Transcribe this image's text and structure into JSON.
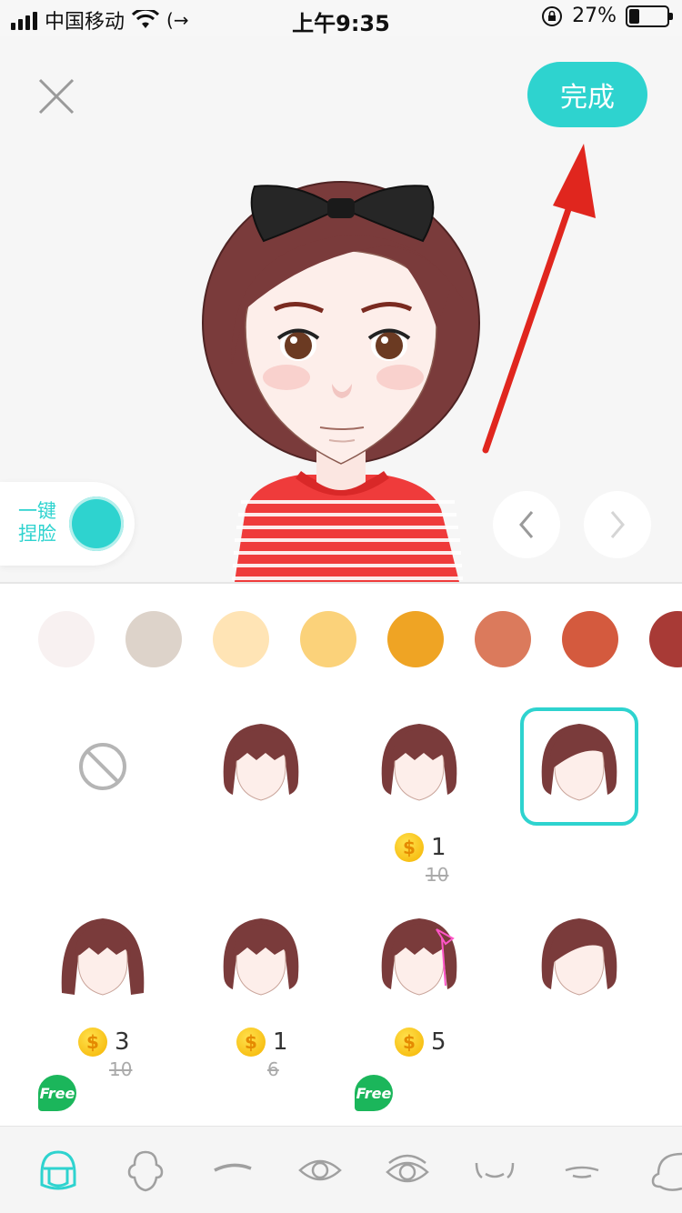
{
  "status_bar": {
    "carrier": "中国移动",
    "time": "上午9:35",
    "battery_pct": "27%",
    "battery_level": 0.27
  },
  "header": {
    "done_label": "完成"
  },
  "pinch": {
    "label": "一键捏脸"
  },
  "colors": {
    "accent": "#2ed3cf",
    "arrow": "#e0261e",
    "hair": "#7a3b3b"
  },
  "palette": [
    "#f8f1f1",
    "#ddd3ca",
    "#ffe4b5",
    "#fbd27a",
    "#efa424",
    "#db7a5c",
    "#d45a3e",
    "#a83a36"
  ],
  "hair_items": [
    {
      "icon": "none-icon",
      "price": null,
      "old_price": null,
      "selected": false,
      "free": false
    },
    {
      "icon": "bob-bangs-hair-icon",
      "price": null,
      "old_price": null,
      "selected": false,
      "free": false
    },
    {
      "icon": "short-bob-hair-icon",
      "price": "1",
      "old_price": "10",
      "selected": false,
      "free": false
    },
    {
      "icon": "side-part-bob-hair-icon",
      "price": null,
      "old_price": null,
      "selected": true,
      "free": false
    },
    {
      "icon": "long-bob-hair-icon",
      "price": "3",
      "old_price": "10",
      "selected": false,
      "free": false
    },
    {
      "icon": "wavy-bob-hair-icon",
      "price": "1",
      "old_price": "6",
      "selected": false,
      "free": false
    },
    {
      "icon": "ribbon-bob-hair-icon",
      "price": "5",
      "old_price": null,
      "selected": false,
      "free": false
    },
    {
      "icon": "side-swept-hair-icon",
      "price": null,
      "old_price": null,
      "selected": false,
      "free": false
    },
    {
      "icon": "free-hair-icon",
      "price": null,
      "old_price": null,
      "selected": false,
      "free": true
    },
    {
      "icon": "topknot-hair-icon",
      "price": null,
      "old_price": null,
      "selected": false,
      "free": false
    },
    {
      "icon": "free-bangs-hair-icon",
      "price": null,
      "old_price": null,
      "selected": false,
      "free": true
    },
    {
      "icon": "straight-bangs-hair-icon",
      "price": null,
      "old_price": null,
      "selected": false,
      "free": false
    }
  ],
  "badges": {
    "coin_symbol": "$",
    "free_label": "Free"
  },
  "tabs": [
    {
      "icon": "hair-tab-icon",
      "active": true
    },
    {
      "icon": "face-shape-tab-icon",
      "active": false
    },
    {
      "icon": "eyebrow-tab-icon",
      "active": false
    },
    {
      "icon": "eye-tab-icon",
      "active": false
    },
    {
      "icon": "eye-detail-tab-icon",
      "active": false
    },
    {
      "icon": "mouth-tab-icon",
      "active": false
    },
    {
      "icon": "lips-tab-icon",
      "active": false
    },
    {
      "icon": "ear-tab-icon",
      "active": false
    }
  ]
}
